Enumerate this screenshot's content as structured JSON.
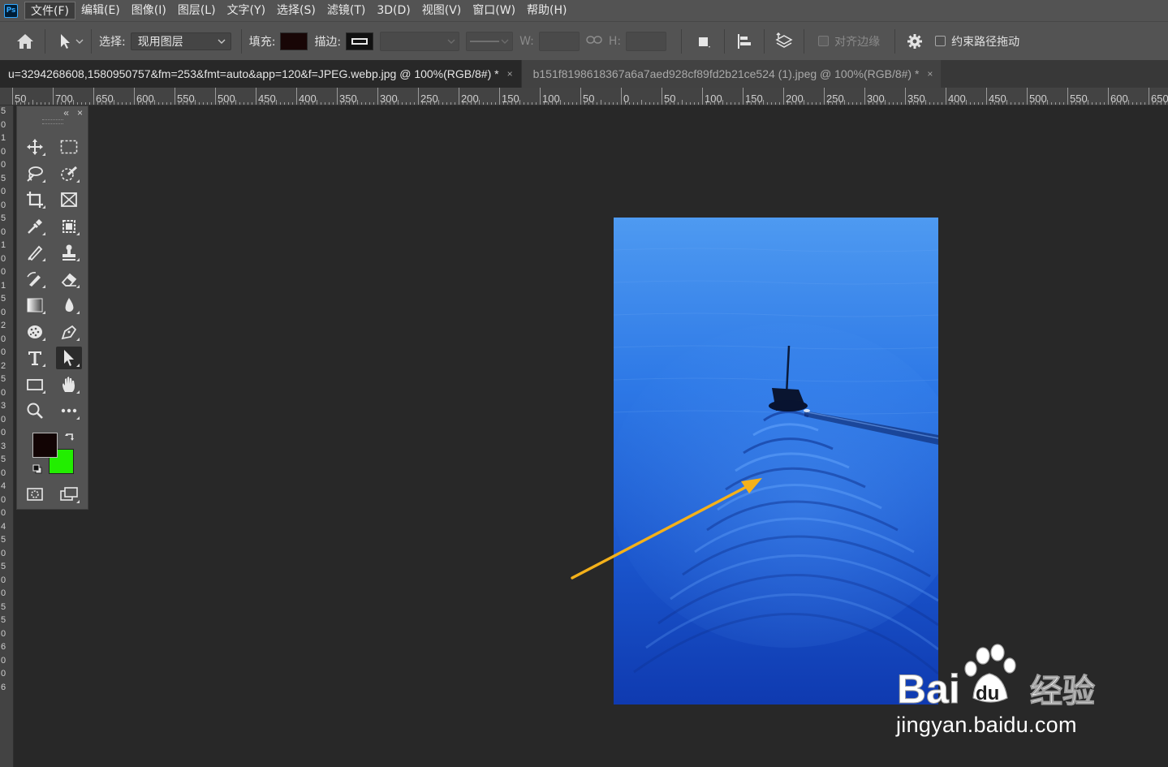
{
  "app": {
    "logo_text": "Ps"
  },
  "menu": {
    "items": [
      "文件(F)",
      "编辑(E)",
      "图像(I)",
      "图层(L)",
      "文字(Y)",
      "选择(S)",
      "滤镜(T)",
      "3D(D)",
      "视图(V)",
      "窗口(W)",
      "帮助(H)"
    ],
    "active_index": 0
  },
  "options": {
    "select_label": "选择:",
    "select_value": "现用图层",
    "fill_label": "填充:",
    "fill_color": "#180606",
    "stroke_label": "描边:",
    "w_label": "W:",
    "h_label": "H:",
    "align_edges_label": "对齐边缘",
    "constrain_path_label": "约束路径拖动"
  },
  "tabs": [
    {
      "title": "u=3294268608,1580950757&fm=253&fmt=auto&app=120&f=JPEG.webp.jpg @ 100%(RGB/8#) *",
      "close": "×",
      "active": true
    },
    {
      "title": "b151f8198618367a6a7aed928cf89fd2b21ce524 (1).jpeg @ 100%(RGB/8#) *",
      "close": "×",
      "active": false
    }
  ],
  "ruler_h": [
    "50",
    "700",
    "650",
    "600",
    "550",
    "500",
    "450",
    "400",
    "350",
    "300",
    "250",
    "200",
    "150",
    "100",
    "50",
    "0",
    "50",
    "100",
    "150",
    "200",
    "250",
    "300",
    "350",
    "400",
    "450",
    "500",
    "550",
    "600",
    "650"
  ],
  "ruler_v": [
    "5",
    "0",
    "1",
    "0",
    "0",
    "5",
    "0",
    "0",
    "5",
    "0",
    "1",
    "0",
    "0",
    "1",
    "5",
    "0",
    "2",
    "0",
    "0",
    "2",
    "5",
    "0",
    "3",
    "0",
    "0",
    "3",
    "5",
    "0",
    "4",
    "0",
    "0",
    "4",
    "5",
    "0",
    "5",
    "0",
    "0",
    "5",
    "5",
    "0",
    "6",
    "0",
    "0",
    "6"
  ],
  "toolbox": {
    "collapse_icon": "«",
    "close_icon": "×",
    "foreground_color": "#120404",
    "background_color": "#22ee00"
  },
  "colors": {
    "arrow": "#f4b11a",
    "water_top": "#4b96ef",
    "water_bottom": "#0f3fb8"
  },
  "watermark": {
    "brand_text": "Bai",
    "paw_text": "du",
    "suffix_text": "经验",
    "url": "jingyan.baidu.com"
  }
}
